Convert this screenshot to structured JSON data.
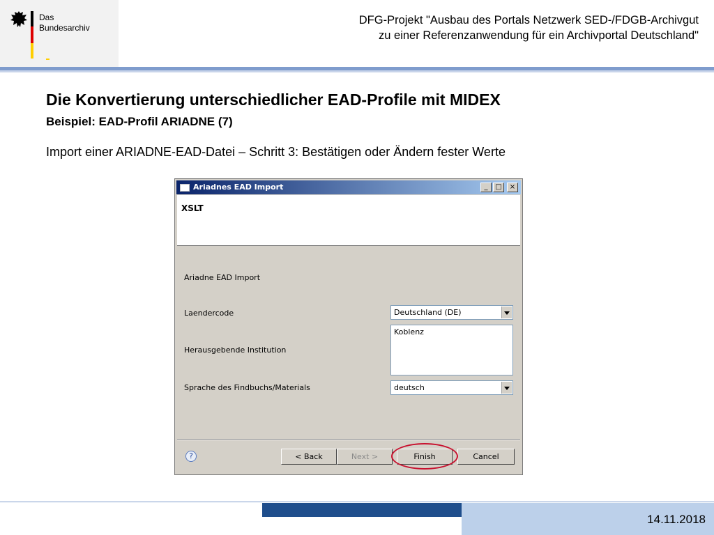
{
  "logo": {
    "line1": "Das",
    "line2": "Bundesarchiv"
  },
  "header": {
    "line1": "DFG-Projekt \"Ausbau des Portals Netzwerk SED-/FDGB-Archivgut",
    "line2": "zu einer Referenzanwendung für ein Archivportal Deutschland\""
  },
  "slide": {
    "title": "Die Konvertierung unterschiedlicher EAD-Profile mit MIDEX",
    "subtitle": "Beispiel: EAD-Profil ARIADNE (7)",
    "description": "Import einer ARIADNE-EAD-Datei – Schritt 3: Bestätigen oder Ändern fester Werte"
  },
  "dialog": {
    "title": "Ariadnes EAD Import",
    "banner_title": "XSLT",
    "section_label": "Ariadne EAD Import",
    "fields": {
      "laendercode_label": "Laendercode",
      "laendercode_value": "Deutschland (DE)",
      "institution_label": "Herausgebende Institution",
      "institution_value": "Koblenz",
      "sprache_label": "Sprache des Findbuchs/Materials",
      "sprache_value": "deutsch"
    },
    "buttons": {
      "back": "< Back",
      "next": "Next >",
      "finish": "Finish",
      "cancel": "Cancel"
    },
    "help_glyph": "?",
    "window_controls": {
      "minimize": "_",
      "maximize": "□",
      "close": "×"
    },
    "highlight_color": "#c8102e"
  },
  "footer": {
    "date": "14.11.2018"
  },
  "colors": {
    "accent": "#7f9ccd",
    "footer_dark": "#1f4e8c",
    "footer_light": "#bcd0ea",
    "titlebar": "#0a246a"
  }
}
